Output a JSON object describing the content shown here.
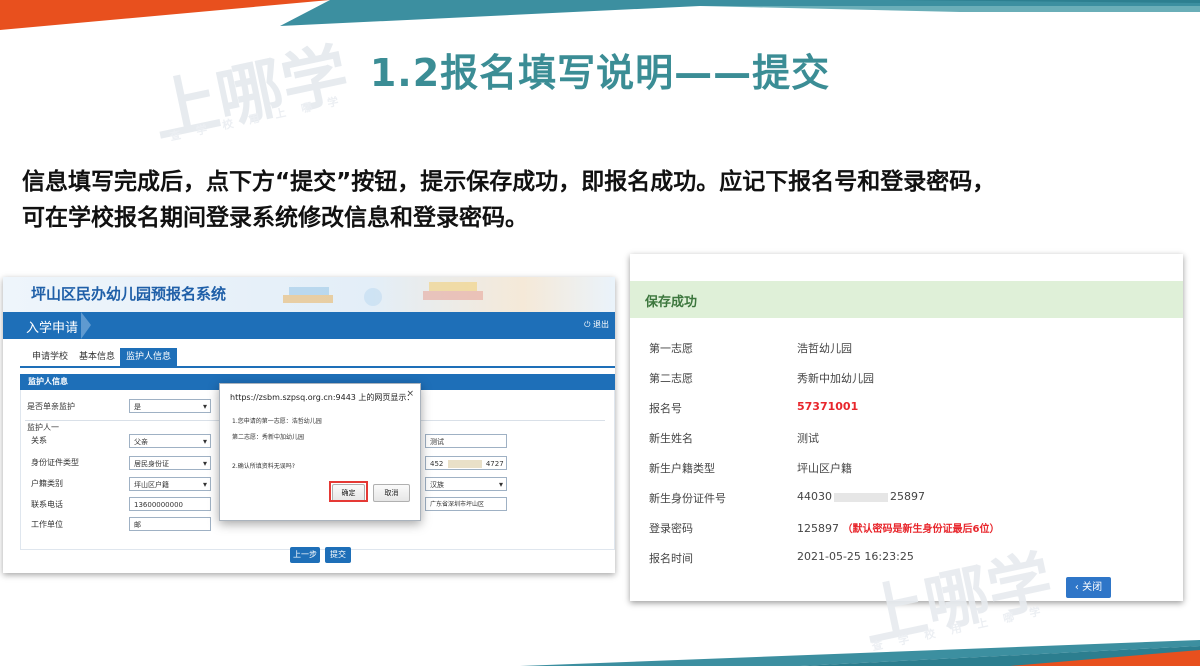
{
  "slide": {
    "title": "1.2报名填写说明——提交",
    "paragraph_line1": "信息填写完成后，点下方“提交”按钮，提示保存成功，即报名成功。应记下报名号和登录密码，",
    "paragraph_line2": "可在学校报名期间登录系统修改信息和登录密码。",
    "watermark": "上哪学",
    "watermark_small": "查 学 校   用 上 哪 学",
    "colors": {
      "title": "#3b8d95",
      "stripe_orange": "#e8501e",
      "stripe_teal": "#3c8fa0"
    }
  },
  "left_screen": {
    "system_title": "坪山区民办幼儿园预报名系统",
    "nav_item": "入学申请",
    "logout": "退出",
    "tabs": [
      "申请学校",
      "基本信息",
      "监护人信息"
    ],
    "section_title": "监护人信息",
    "single_parent_label": "是否单亲监护",
    "single_parent_value": "是",
    "guardian_label": "监护人一",
    "fields": [
      {
        "label": "关系",
        "value": "父亲"
      },
      {
        "label": "身份证件类型",
        "value": "居民身份证"
      },
      {
        "label": "户籍类别",
        "value": "坪山区户籍"
      },
      {
        "label": "联系电话",
        "value": "13600000000"
      },
      {
        "label": "工作单位",
        "value": "邮"
      }
    ],
    "right_fields": [
      "测试",
      "452",
      "4727",
      "汉族",
      "广东省深圳市坪山区"
    ],
    "buttons": {
      "prev": "上一步",
      "submit": "提交"
    },
    "dialog": {
      "title": "https://zsbm.szpsq.org.cn:9443 上的网页显示：",
      "line1": "1.您申请的第一志愿：浩哲幼儿园",
      "line2": "第二志愿：秀新中加幼儿园",
      "line3": "2.确认所填资料无误吗?",
      "ok": "确定",
      "cancel": "取消",
      "close": "×"
    }
  },
  "right_screen": {
    "banner": "保存成功",
    "rows": [
      {
        "label": "第一志愿",
        "value": "浩哲幼儿园"
      },
      {
        "label": "第二志愿",
        "value": "秀新中加幼儿园"
      },
      {
        "label": "报名号",
        "value": "57371001"
      },
      {
        "label": "新生姓名",
        "value": "测试"
      },
      {
        "label": "新生户籍类型",
        "value": "坪山区户籍"
      },
      {
        "label": "新生身份证件号",
        "value": "44030",
        "value_end": "25897"
      },
      {
        "label": "登录密码",
        "value": "125897",
        "note": "（默认密码是新生身份证最后6位）"
      },
      {
        "label": "报名时间",
        "value": "2021-05-25 16:23:25"
      }
    ],
    "close_button": "关闭"
  }
}
